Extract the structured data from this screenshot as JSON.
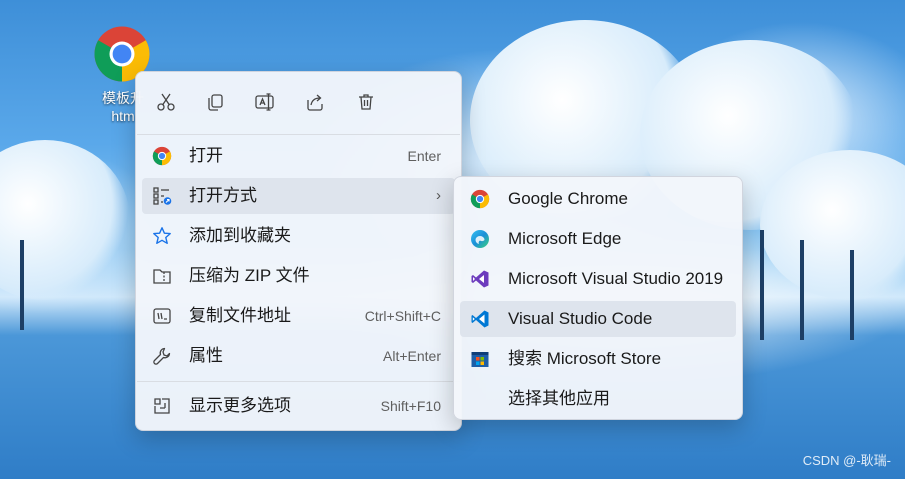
{
  "desktop_icon": {
    "label_line1": "模板升",
    "label_line2": "htm",
    "icon": "chrome-icon"
  },
  "toolbar": {
    "items": [
      {
        "name": "cut-icon",
        "interactable": true
      },
      {
        "name": "copy-icon",
        "interactable": true
      },
      {
        "name": "rename-icon",
        "interactable": true
      },
      {
        "name": "share-icon",
        "interactable": true
      },
      {
        "name": "delete-icon",
        "interactable": true
      }
    ]
  },
  "main_menu": {
    "items": [
      {
        "label": "打开",
        "shortcut": "Enter",
        "icon": "chrome-icon"
      },
      {
        "label": "打开方式",
        "shortcut": "",
        "icon": "open-with-icon",
        "arrow": "›"
      },
      {
        "label": "添加到收藏夹",
        "shortcut": "",
        "icon": "star-icon"
      },
      {
        "label": "压缩为 ZIP 文件",
        "shortcut": "",
        "icon": "zip-folder-icon"
      },
      {
        "label": "复制文件地址",
        "shortcut": "Ctrl+Shift+C",
        "icon": "copy-path-icon"
      },
      {
        "label": "属性",
        "shortcut": "Alt+Enter",
        "icon": "wrench-icon"
      },
      {
        "label": "显示更多选项",
        "shortcut": "Shift+F10",
        "icon": "more-options-icon"
      }
    ]
  },
  "sub_menu": {
    "items": [
      {
        "label": "Google Chrome",
        "icon": "chrome-icon"
      },
      {
        "label": "Microsoft Edge",
        "icon": "edge-icon"
      },
      {
        "label": "Microsoft Visual Studio 2019",
        "icon": "visual-studio-icon"
      },
      {
        "label": "Visual Studio Code",
        "icon": "vscode-icon"
      },
      {
        "label": "搜索 Microsoft Store",
        "icon": "store-icon"
      },
      {
        "label": "选择其他应用",
        "icon": ""
      }
    ]
  },
  "watermark": "CSDN @-耿瑞-",
  "colors": {
    "accent_blue": "#1a73e8",
    "vscode_blue": "#0078d4",
    "vs_purple": "#6c3bbd"
  }
}
